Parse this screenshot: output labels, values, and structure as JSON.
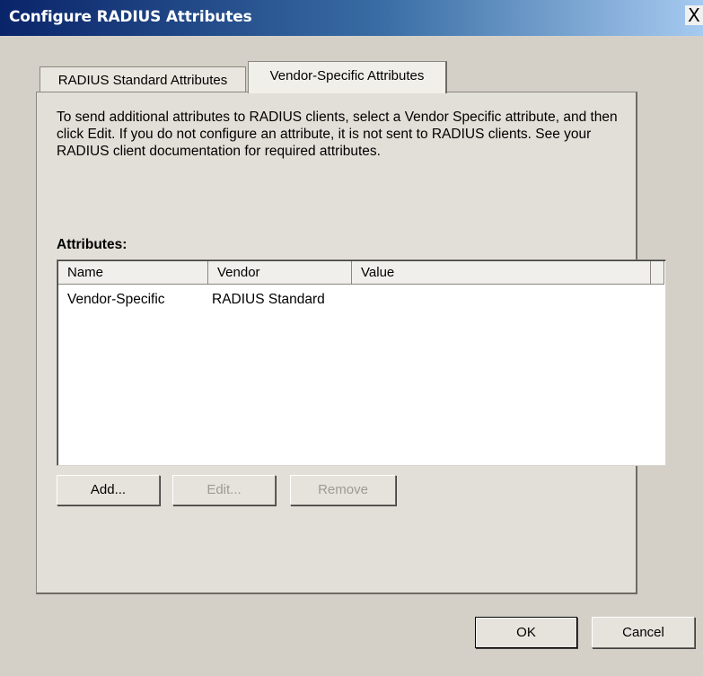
{
  "window": {
    "title": "Configure RADIUS Attributes",
    "close_glyph": "X"
  },
  "tabs": [
    {
      "label": "RADIUS Standard Attributes",
      "selected": false
    },
    {
      "label": "Vendor-Specific Attributes",
      "selected": true
    }
  ],
  "panel": {
    "description": "To send additional attributes to RADIUS clients, select a Vendor Specific attribute, and then click Edit. If you do not configure an attribute, it is not sent to RADIUS clients. See your RADIUS client documentation for required attributes.",
    "attributes_label": "Attributes:",
    "columns": [
      "Name",
      "Vendor",
      "Value"
    ],
    "rows": [
      {
        "name": "Vendor-Specific",
        "vendor": "RADIUS Standard",
        "value": ""
      }
    ],
    "buttons": {
      "add": "Add...",
      "edit": "Edit...",
      "remove": "Remove"
    }
  },
  "footer": {
    "ok": "OK",
    "cancel": "Cancel"
  },
  "colors": {
    "title_gradient_start": "#0a246a",
    "title_gradient_end": "#a6caf0",
    "dialog_bg": "#d4d0c8",
    "disabled_text": "#9d9a93"
  }
}
